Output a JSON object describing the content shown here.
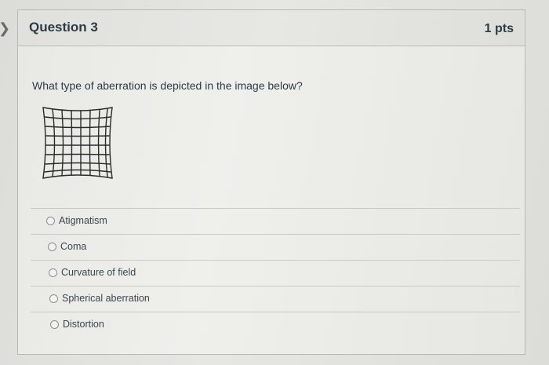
{
  "question": {
    "title": "Question 3",
    "points": "1 pts",
    "text": "What type of aberration is depicted in the image below?"
  },
  "answers": [
    {
      "label": "Atigmatism"
    },
    {
      "label": "Coma"
    },
    {
      "label": "Curvature of field"
    },
    {
      "label": "Spherical aberration"
    },
    {
      "label": "Distortion"
    }
  ],
  "figure": {
    "description_icon": "pincushion-grid-icon"
  }
}
